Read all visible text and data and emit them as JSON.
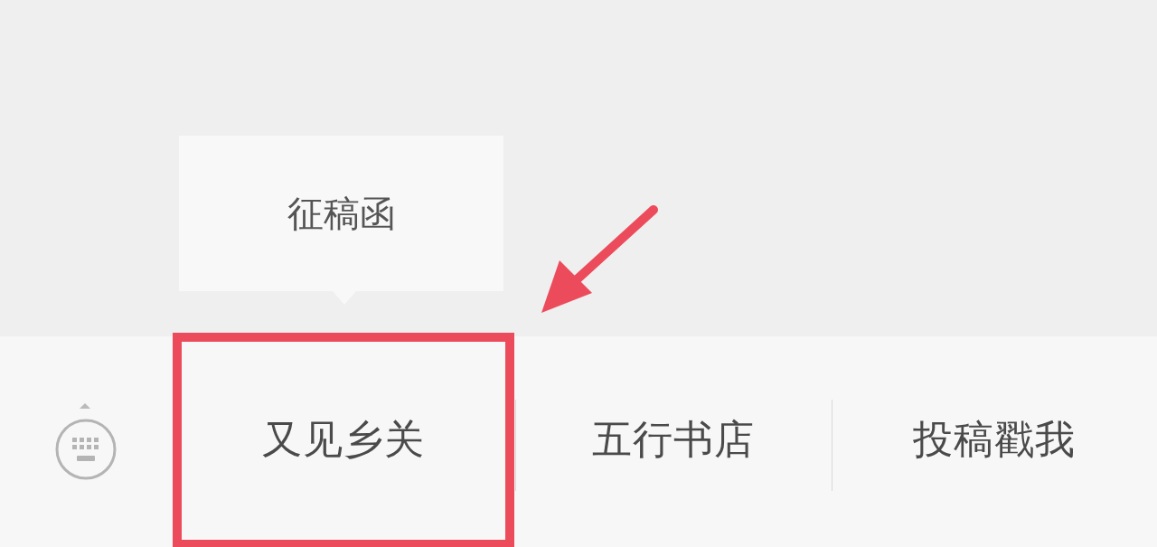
{
  "menu": {
    "items": [
      {
        "label": "又见乡关",
        "highlighted": true,
        "submenu": [
          {
            "label": "征稿函"
          }
        ]
      },
      {
        "label": "五行书店",
        "highlighted": false
      },
      {
        "label": "投稿戳我",
        "highlighted": false
      }
    ]
  }
}
